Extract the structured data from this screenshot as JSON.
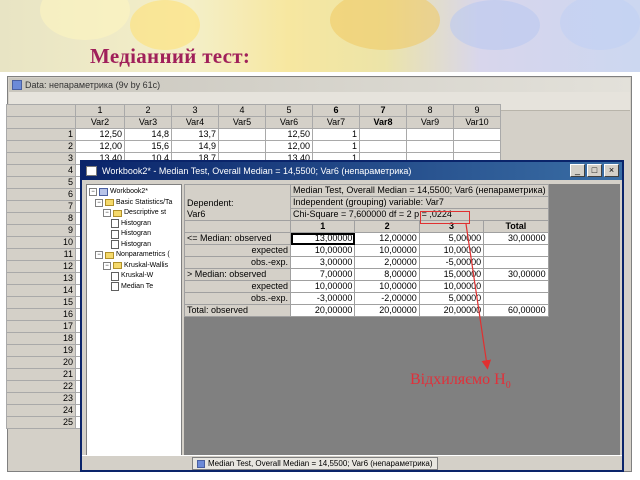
{
  "slide": {
    "title": "Медіанний тест:"
  },
  "data_window": {
    "title": "Data: непараметрика (9v by 61c)",
    "col_numbers": [
      "1",
      "2",
      "3",
      "4",
      "5",
      "6",
      "7",
      "8",
      "9"
    ],
    "col_names": [
      "Var2",
      "Var3",
      "Var4",
      "Var5",
      "Var6",
      "Var7",
      "Var8",
      "Var9",
      "Var10"
    ],
    "rows": [
      {
        "n": "1",
        "v": [
          "12,50",
          "14,8",
          "13,7",
          "",
          "12,50",
          "1",
          "",
          "",
          ""
        ]
      },
      {
        "n": "2",
        "v": [
          "12,00",
          "15,6",
          "14,9",
          "",
          "12,00",
          "1",
          "",
          "",
          ""
        ]
      },
      {
        "n": "3",
        "v": [
          "13,40",
          "10,4",
          "18,7",
          "",
          "13,40",
          "1",
          "",
          "",
          ""
        ]
      },
      {
        "n": "4",
        "v": [
          "",
          "",
          "",
          "",
          "",
          "",
          "",
          "",
          ""
        ]
      },
      {
        "n": "5",
        "v": [
          "",
          "",
          "",
          "",
          "",
          "",
          "",
          "",
          ""
        ]
      },
      {
        "n": "6",
        "v": [
          "",
          "",
          "",
          "",
          "",
          "",
          "",
          "",
          ""
        ]
      },
      {
        "n": "7",
        "v": [
          "",
          "",
          "",
          "",
          "",
          "",
          "",
          "",
          ""
        ]
      },
      {
        "n": "8",
        "v": [
          "",
          "",
          "",
          "",
          "",
          "",
          "",
          "",
          ""
        ]
      },
      {
        "n": "9",
        "v": [
          "",
          "",
          "",
          "",
          "",
          "",
          "",
          "",
          ""
        ]
      },
      {
        "n": "10",
        "v": [
          "",
          "",
          "",
          "",
          "",
          "",
          "",
          "",
          ""
        ]
      },
      {
        "n": "11",
        "v": [
          "",
          "",
          "",
          "",
          "",
          "",
          "",
          "",
          ""
        ]
      },
      {
        "n": "12",
        "v": [
          "",
          "",
          "",
          "",
          "",
          "",
          "",
          "",
          ""
        ]
      },
      {
        "n": "13",
        "v": [
          "",
          "",
          "",
          "",
          "",
          "",
          "",
          "",
          ""
        ]
      },
      {
        "n": "14",
        "v": [
          "",
          "",
          "",
          "",
          "",
          "",
          "",
          "",
          ""
        ]
      },
      {
        "n": "15",
        "v": [
          "",
          "",
          "",
          "",
          "",
          "",
          "",
          "",
          ""
        ]
      },
      {
        "n": "16",
        "v": [
          "",
          "",
          "",
          "",
          "",
          "",
          "",
          "",
          ""
        ]
      },
      {
        "n": "17",
        "v": [
          "",
          "",
          "",
          "",
          "",
          "",
          "",
          "",
          ""
        ]
      },
      {
        "n": "18",
        "v": [
          "",
          "",
          "",
          "",
          "",
          "",
          "",
          "",
          ""
        ]
      },
      {
        "n": "19",
        "v": [
          "",
          "",
          "",
          "",
          "",
          "",
          "",
          "",
          ""
        ]
      },
      {
        "n": "20",
        "v": [
          "",
          "",
          "",
          "",
          "",
          "",
          "",
          "",
          ""
        ]
      },
      {
        "n": "21",
        "v": [
          "",
          "",
          "",
          "",
          "",
          "",
          "",
          "",
          ""
        ]
      },
      {
        "n": "22",
        "v": [
          "",
          "",
          "",
          "",
          "",
          "",
          "",
          "",
          ""
        ]
      },
      {
        "n": "23",
        "v": [
          "",
          "",
          "",
          "",
          "",
          "",
          "",
          "",
          ""
        ]
      },
      {
        "n": "24",
        "v": [
          "",
          "",
          "",
          "",
          "",
          "",
          "",
          "",
          ""
        ]
      },
      {
        "n": "25",
        "v": [
          "",
          "",
          "",
          "",
          "",
          "",
          "",
          "",
          ""
        ]
      }
    ]
  },
  "workbook": {
    "title": "Workbook2* - Median Test, Overall Median = 14,5500; Var6 (непараметрика)",
    "buttons": [
      "_",
      "□",
      "×"
    ],
    "tree": [
      {
        "label": "Workbook2*",
        "type": "book"
      },
      {
        "label": "Basic Statistics/Ta",
        "type": "folder"
      },
      {
        "label": "Descriptive st",
        "type": "folder"
      },
      {
        "label": "Histogran",
        "type": "doc"
      },
      {
        "label": "Histogran",
        "type": "doc"
      },
      {
        "label": "Histogran",
        "type": "doc"
      },
      {
        "label": "Nonparametrics (",
        "type": "folder"
      },
      {
        "label": "Kruskal-Wallis",
        "type": "folder"
      },
      {
        "label": "Kruskal-W",
        "type": "doc"
      },
      {
        "label": "Median Te",
        "type": "doc"
      }
    ],
    "header": {
      "dependent_label": "Dependent:",
      "dependent_var": "Var6",
      "line1": "Median Test, Overall Median = 14,5500; Var6 (непараметрика)",
      "line2": "Independent (grouping) variable: Var7",
      "line3": "Chi-Square = 7,600000 df = 2 p = ,0224"
    },
    "col_heads": [
      "1",
      "2",
      "3",
      "Total"
    ],
    "rows": [
      {
        "label": "<= Median:  observed",
        "v": [
          "13,00000",
          "12,00000",
          "5,00000",
          "30,00000"
        ]
      },
      {
        "label": "expected",
        "v": [
          "10,00000",
          "10,00000",
          "10,00000",
          ""
        ]
      },
      {
        "label": "obs.-exp.",
        "v": [
          "3,00000",
          "2,00000",
          "-5,00000",
          ""
        ]
      },
      {
        "label": ">  Median:  observed",
        "v": [
          "7,00000",
          "8,00000",
          "15,00000",
          "30,00000"
        ]
      },
      {
        "label": "expected",
        "v": [
          "10,00000",
          "10,00000",
          "10,00000",
          ""
        ]
      },
      {
        "label": "obs.-exp.",
        "v": [
          "-3,00000",
          "-2,00000",
          "5,00000",
          ""
        ]
      },
      {
        "label": "Total:  observed",
        "v": [
          "20,00000",
          "20,00000",
          "20,00000",
          "60,00000"
        ]
      }
    ],
    "taskbar_tab": "Median Test, Overall Median = 14,5500; Var6 (непараметрика)"
  },
  "annotation": {
    "text": "Відхиляємо H",
    "subscript": "0"
  },
  "colors": {
    "title": "#a0205a",
    "annotation": "#e0303a",
    "titlebar": "#0a246a"
  }
}
